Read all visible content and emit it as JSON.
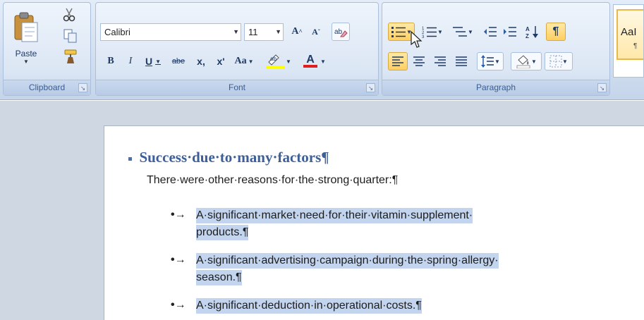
{
  "ribbon": {
    "clipboard": {
      "label": "Clipboard",
      "paste_label": "Paste"
    },
    "font": {
      "label": "Font",
      "font_name": "Calibri",
      "font_size": "11",
      "bold": "B",
      "italic": "I",
      "underline": "U",
      "strike": "abe",
      "subscript": "x,",
      "superscript": "x'",
      "change_case": "Aa",
      "grow_font": "A",
      "shrink_font": "A",
      "font_color": "A"
    },
    "paragraph": {
      "label": "Paragraph",
      "pilcrow": "¶"
    },
    "styles": {
      "preview": "AaI",
      "pilcrow": "¶"
    }
  },
  "document": {
    "heading": "Success·due·to·many·factors¶",
    "intro": "There·were·other·reasons·for·the·strong·quarter:¶",
    "bullets": [
      {
        "marker": "•→",
        "line1": "A·significant·market·need·for·their·vitamin·supplement·",
        "line2": "products.¶"
      },
      {
        "marker": "•→",
        "line1": "A·significant·advertising·campaign·during·the·spring·allergy·",
        "line2": "season.¶"
      },
      {
        "marker": "•→",
        "line1": "A·significant·deduction·in·operational·costs.¶",
        "line2": ""
      }
    ]
  }
}
